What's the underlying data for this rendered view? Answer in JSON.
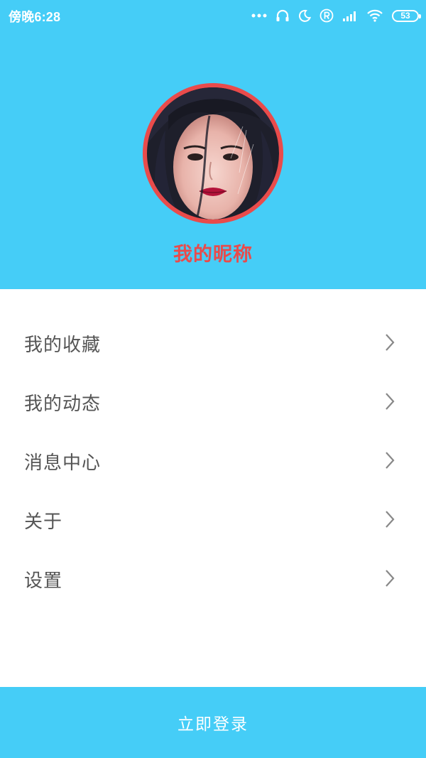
{
  "status_bar": {
    "time": "傍晚6:28",
    "battery": "53",
    "icons": [
      "more-dots-icon",
      "headset-icon",
      "moon-icon",
      "registered-icon",
      "signal-icon",
      "wifi-icon",
      "battery-icon"
    ]
  },
  "profile": {
    "nickname": "我的昵称",
    "avatar_icon": "avatar-photo"
  },
  "menu": {
    "items": [
      {
        "label": "我的收藏",
        "icon": "chevron-right-icon"
      },
      {
        "label": "我的动态",
        "icon": "chevron-right-icon"
      },
      {
        "label": "消息中心",
        "icon": "chevron-right-icon"
      },
      {
        "label": "关于",
        "icon": "chevron-right-icon"
      },
      {
        "label": "设置",
        "icon": "chevron-right-icon"
      }
    ]
  },
  "login": {
    "label": "立即登录"
  },
  "colors": {
    "header_bg": "#45cdf7",
    "accent_red": "#e94b4b",
    "menu_text": "#555555",
    "chevron": "#888888"
  }
}
